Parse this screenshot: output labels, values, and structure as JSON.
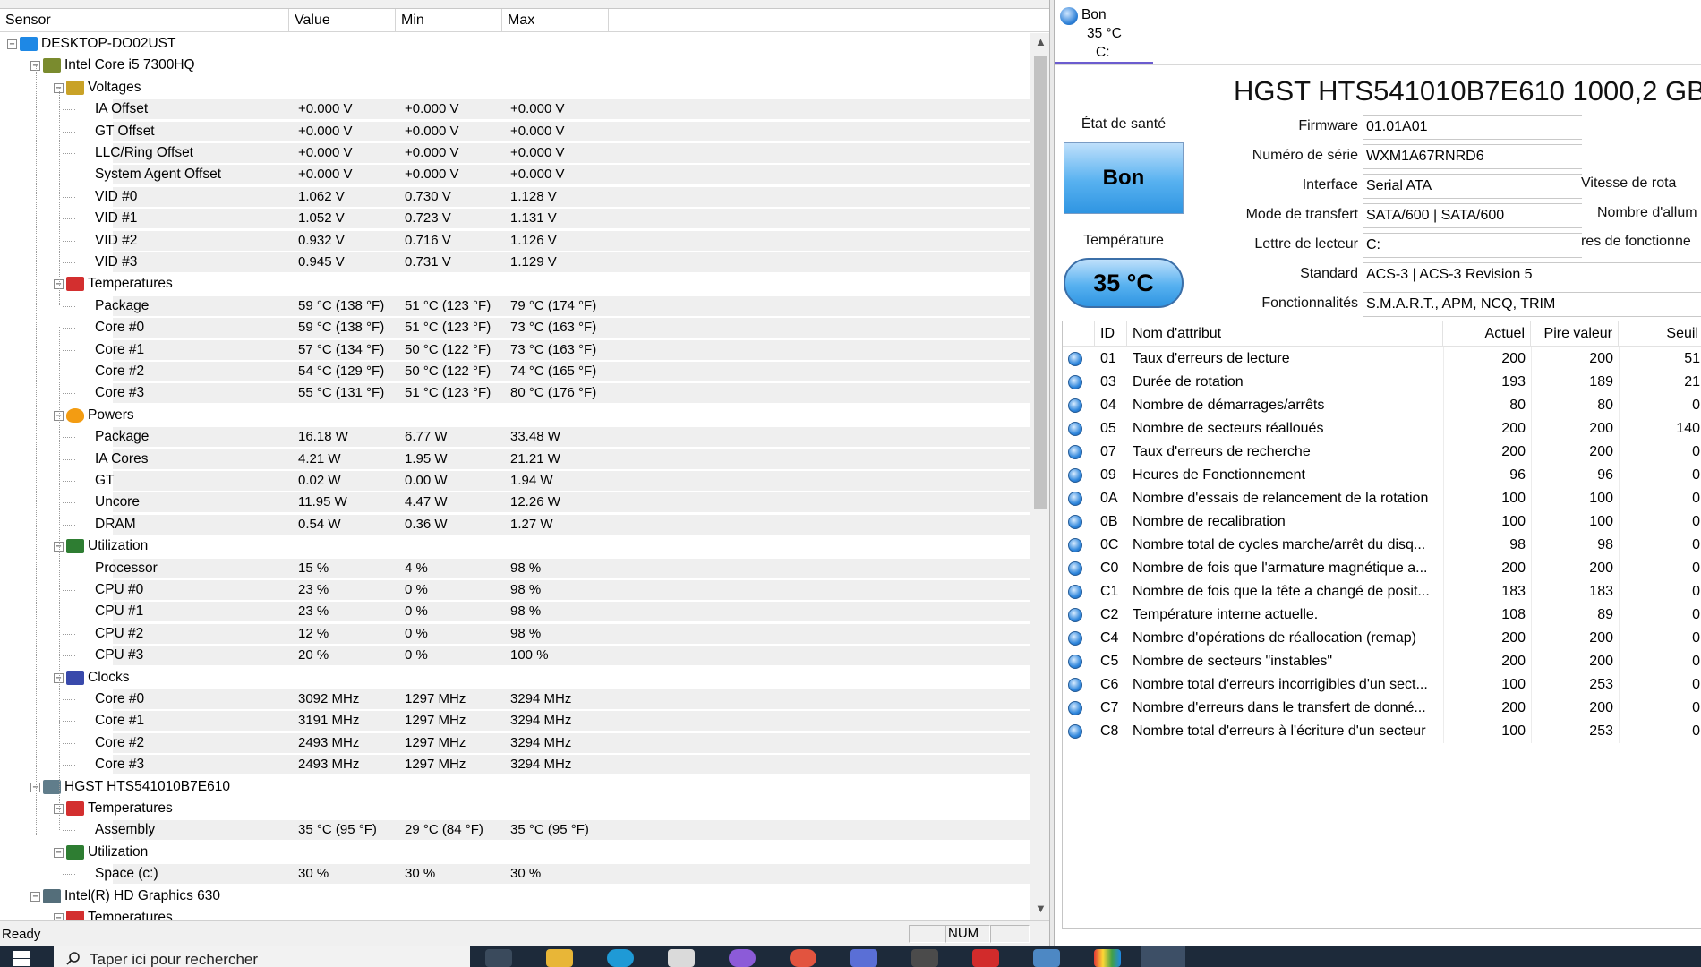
{
  "hwmonitor": {
    "columns": [
      "Sensor",
      "Value",
      "Min",
      "Max"
    ],
    "tree": [
      {
        "level": 0,
        "type": "device",
        "icon": "computer-icon",
        "label": "DESKTOP-DO02UST",
        "toggle": "-"
      },
      {
        "level": 1,
        "type": "device",
        "icon": "cpu-chip-icon",
        "label": "Intel Core i5 7300HQ",
        "toggle": "-"
      },
      {
        "level": 2,
        "type": "group",
        "icon": "voltage-icon",
        "label": "Voltages",
        "toggle": "-"
      },
      {
        "level": 3,
        "type": "leaf",
        "label": "IA Offset",
        "value": "+0.000 V",
        "min": "+0.000 V",
        "max": "+0.000 V"
      },
      {
        "level": 3,
        "type": "leaf",
        "label": "GT Offset",
        "value": "+0.000 V",
        "min": "+0.000 V",
        "max": "+0.000 V"
      },
      {
        "level": 3,
        "type": "leaf",
        "label": "LLC/Ring Offset",
        "value": "+0.000 V",
        "min": "+0.000 V",
        "max": "+0.000 V"
      },
      {
        "level": 3,
        "type": "leaf",
        "label": "System Agent Offset",
        "value": "+0.000 V",
        "min": "+0.000 V",
        "max": "+0.000 V"
      },
      {
        "level": 3,
        "type": "leaf",
        "label": "VID #0",
        "value": "1.062 V",
        "min": "0.730 V",
        "max": "1.128 V"
      },
      {
        "level": 3,
        "type": "leaf",
        "label": "VID #1",
        "value": "1.052 V",
        "min": "0.723 V",
        "max": "1.131 V"
      },
      {
        "level": 3,
        "type": "leaf",
        "label": "VID #2",
        "value": "0.932 V",
        "min": "0.716 V",
        "max": "1.126 V"
      },
      {
        "level": 3,
        "type": "leaf",
        "label": "VID #3",
        "value": "0.945 V",
        "min": "0.731 V",
        "max": "1.129 V"
      },
      {
        "level": 2,
        "type": "group",
        "icon": "thermometer-icon",
        "label": "Temperatures",
        "toggle": "-"
      },
      {
        "level": 3,
        "type": "leaf",
        "label": "Package",
        "value": "59 °C  (138 °F)",
        "min": "51 °C  (123 °F)",
        "max": "79 °C  (174 °F)"
      },
      {
        "level": 3,
        "type": "leaf",
        "label": "Core #0",
        "value": "59 °C  (138 °F)",
        "min": "51 °C  (123 °F)",
        "max": "73 °C  (163 °F)"
      },
      {
        "level": 3,
        "type": "leaf",
        "label": "Core #1",
        "value": "57 °C  (134 °F)",
        "min": "50 °C  (122 °F)",
        "max": "73 °C  (163 °F)"
      },
      {
        "level": 3,
        "type": "leaf",
        "label": "Core #2",
        "value": "54 °C  (129 °F)",
        "min": "50 °C  (122 °F)",
        "max": "74 °C  (165 °F)"
      },
      {
        "level": 3,
        "type": "leaf",
        "label": "Core #3",
        "value": "55 °C  (131 °F)",
        "min": "51 °C  (123 °F)",
        "max": "80 °C  (176 °F)"
      },
      {
        "level": 2,
        "type": "group",
        "icon": "flame-icon",
        "label": "Powers",
        "toggle": "-"
      },
      {
        "level": 3,
        "type": "leaf",
        "label": "Package",
        "value": "16.18 W",
        "min": "6.77 W",
        "max": "33.48 W"
      },
      {
        "level": 3,
        "type": "leaf",
        "label": "IA Cores",
        "value": "4.21 W",
        "min": "1.95 W",
        "max": "21.21 W"
      },
      {
        "level": 3,
        "type": "leaf",
        "label": "GT",
        "value": "0.02 W",
        "min": "0.00 W",
        "max": "1.94 W"
      },
      {
        "level": 3,
        "type": "leaf",
        "label": "Uncore",
        "value": "11.95 W",
        "min": "4.47 W",
        "max": "12.26 W"
      },
      {
        "level": 3,
        "type": "leaf",
        "label": "DRAM",
        "value": "0.54 W",
        "min": "0.36 W",
        "max": "1.27 W"
      },
      {
        "level": 2,
        "type": "group",
        "icon": "utilization-graph-icon",
        "label": "Utilization",
        "toggle": "-"
      },
      {
        "level": 3,
        "type": "leaf",
        "label": "Processor",
        "value": "15 %",
        "min": "4 %",
        "max": "98 %"
      },
      {
        "level": 3,
        "type": "leaf",
        "label": "CPU #0",
        "value": "23 %",
        "min": "0 %",
        "max": "98 %"
      },
      {
        "level": 3,
        "type": "leaf",
        "label": "CPU #1",
        "value": "23 %",
        "min": "0 %",
        "max": "98 %"
      },
      {
        "level": 3,
        "type": "leaf",
        "label": "CPU #2",
        "value": "12 %",
        "min": "0 %",
        "max": "98 %"
      },
      {
        "level": 3,
        "type": "leaf",
        "label": "CPU #3",
        "value": "20 %",
        "min": "0 %",
        "max": "100 %"
      },
      {
        "level": 2,
        "type": "group",
        "icon": "clock-wave-icon",
        "label": "Clocks",
        "toggle": "-"
      },
      {
        "level": 3,
        "type": "leaf",
        "label": "Core #0",
        "value": "3092 MHz",
        "min": "1297 MHz",
        "max": "3294 MHz"
      },
      {
        "level": 3,
        "type": "leaf",
        "label": "Core #1",
        "value": "3191 MHz",
        "min": "1297 MHz",
        "max": "3294 MHz"
      },
      {
        "level": 3,
        "type": "leaf",
        "label": "Core #2",
        "value": "2493 MHz",
        "min": "1297 MHz",
        "max": "3294 MHz"
      },
      {
        "level": 3,
        "type": "leaf",
        "label": "Core #3",
        "value": "2493 MHz",
        "min": "1297 MHz",
        "max": "3294 MHz"
      },
      {
        "level": 1,
        "type": "device",
        "icon": "hard-drive-icon",
        "label": "HGST HTS541010B7E610",
        "toggle": "-"
      },
      {
        "level": 2,
        "type": "group",
        "icon": "thermometer-icon",
        "label": "Temperatures",
        "toggle": "-"
      },
      {
        "level": 3,
        "type": "leaf",
        "label": "Assembly",
        "value": "35 °C  (95 °F)",
        "min": "29 °C  (84 °F)",
        "max": "35 °C  (95 °F)"
      },
      {
        "level": 2,
        "type": "group",
        "icon": "utilization-graph-icon",
        "label": "Utilization",
        "toggle": "-"
      },
      {
        "level": 3,
        "type": "leaf",
        "label": "Space (c:)",
        "value": "30 %",
        "min": "30 %",
        "max": "30 %"
      },
      {
        "level": 1,
        "type": "device",
        "icon": "gpu-card-icon",
        "label": "Intel(R) HD Graphics 630",
        "toggle": "-"
      },
      {
        "level": 2,
        "type": "group",
        "icon": "thermometer-icon",
        "label": "Temperatures",
        "toggle": "-"
      }
    ],
    "status": {
      "ready": "Ready",
      "num": "NUM"
    }
  },
  "crystaldiskinfo": {
    "tab": {
      "status": "Bon",
      "temp": "35 °C",
      "drive": "C:"
    },
    "title": "HGST HTS541010B7E610 1000,2 GB",
    "health_label": "État de santé",
    "health_value": "Bon",
    "temp_label": "Température",
    "temp_value": "35 °C",
    "info": [
      {
        "label": "Firmware",
        "value": "01.01A01"
      },
      {
        "label": "Numéro de série",
        "value": "WXM1A67RNRD6"
      },
      {
        "label": "Interface",
        "value": "Serial ATA"
      },
      {
        "label": "Mode de transfert",
        "value": "SATA/600 | SATA/600"
      },
      {
        "label": "Lettre de lecteur",
        "value": "C:"
      },
      {
        "label": "Standard",
        "value": "ACS-3 | ACS-3 Revision 5"
      },
      {
        "label": "Fonctionnalités",
        "value": "S.M.A.R.T., APM, NCQ, TRIM"
      }
    ],
    "right_labels": [
      "Vitesse de rota",
      "Nombre d'allum",
      "res de fonctionne"
    ],
    "attr_columns": [
      "ID",
      "Nom d'attribut",
      "Actuel",
      "Pire valeur",
      "Seuil"
    ],
    "attributes": [
      {
        "id": "01",
        "name": "Taux d'erreurs de lecture",
        "current": "200",
        "worst": "200",
        "threshold": "51"
      },
      {
        "id": "03",
        "name": "Durée de rotation",
        "current": "193",
        "worst": "189",
        "threshold": "21"
      },
      {
        "id": "04",
        "name": "Nombre de démarrages/arrêts",
        "current": "80",
        "worst": "80",
        "threshold": "0"
      },
      {
        "id": "05",
        "name": "Nombre de secteurs réalloués",
        "current": "200",
        "worst": "200",
        "threshold": "140"
      },
      {
        "id": "07",
        "name": "Taux d'erreurs de recherche",
        "current": "200",
        "worst": "200",
        "threshold": "0"
      },
      {
        "id": "09",
        "name": "Heures de Fonctionnement",
        "current": "96",
        "worst": "96",
        "threshold": "0"
      },
      {
        "id": "0A",
        "name": "Nombre d'essais de relancement de la rotation",
        "current": "100",
        "worst": "100",
        "threshold": "0"
      },
      {
        "id": "0B",
        "name": "Nombre de recalibration",
        "current": "100",
        "worst": "100",
        "threshold": "0"
      },
      {
        "id": "0C",
        "name": "Nombre total de cycles marche/arrêt du disq...",
        "current": "98",
        "worst": "98",
        "threshold": "0"
      },
      {
        "id": "C0",
        "name": "Nombre de fois que l'armature magnétique a...",
        "current": "200",
        "worst": "200",
        "threshold": "0"
      },
      {
        "id": "C1",
        "name": "Nombre de fois que la tête a changé de posit...",
        "current": "183",
        "worst": "183",
        "threshold": "0"
      },
      {
        "id": "C2",
        "name": "Température interne actuelle.",
        "current": "108",
        "worst": "89",
        "threshold": "0"
      },
      {
        "id": "C4",
        "name": "Nombre d'opérations de réallocation (remap)",
        "current": "200",
        "worst": "200",
        "threshold": "0"
      },
      {
        "id": "C5",
        "name": "Nombre de secteurs \"instables\"",
        "current": "200",
        "worst": "200",
        "threshold": "0"
      },
      {
        "id": "C6",
        "name": "Nombre total d'erreurs incorrigibles d'un sect...",
        "current": "100",
        "worst": "253",
        "threshold": "0"
      },
      {
        "id": "C7",
        "name": "Nombre d'erreurs dans le transfert de donné...",
        "current": "200",
        "worst": "200",
        "threshold": "0"
      },
      {
        "id": "C8",
        "name": "Nombre total d'erreurs à l'écriture d'un secteur",
        "current": "100",
        "worst": "253",
        "threshold": "0"
      }
    ]
  },
  "taskbar": {
    "search_placeholder": "Taper ici pour rechercher"
  },
  "colors": {
    "health_good": "#57b1f0",
    "tab_accent": "#6b5ccf",
    "taskbar": "#1d2a3a"
  }
}
